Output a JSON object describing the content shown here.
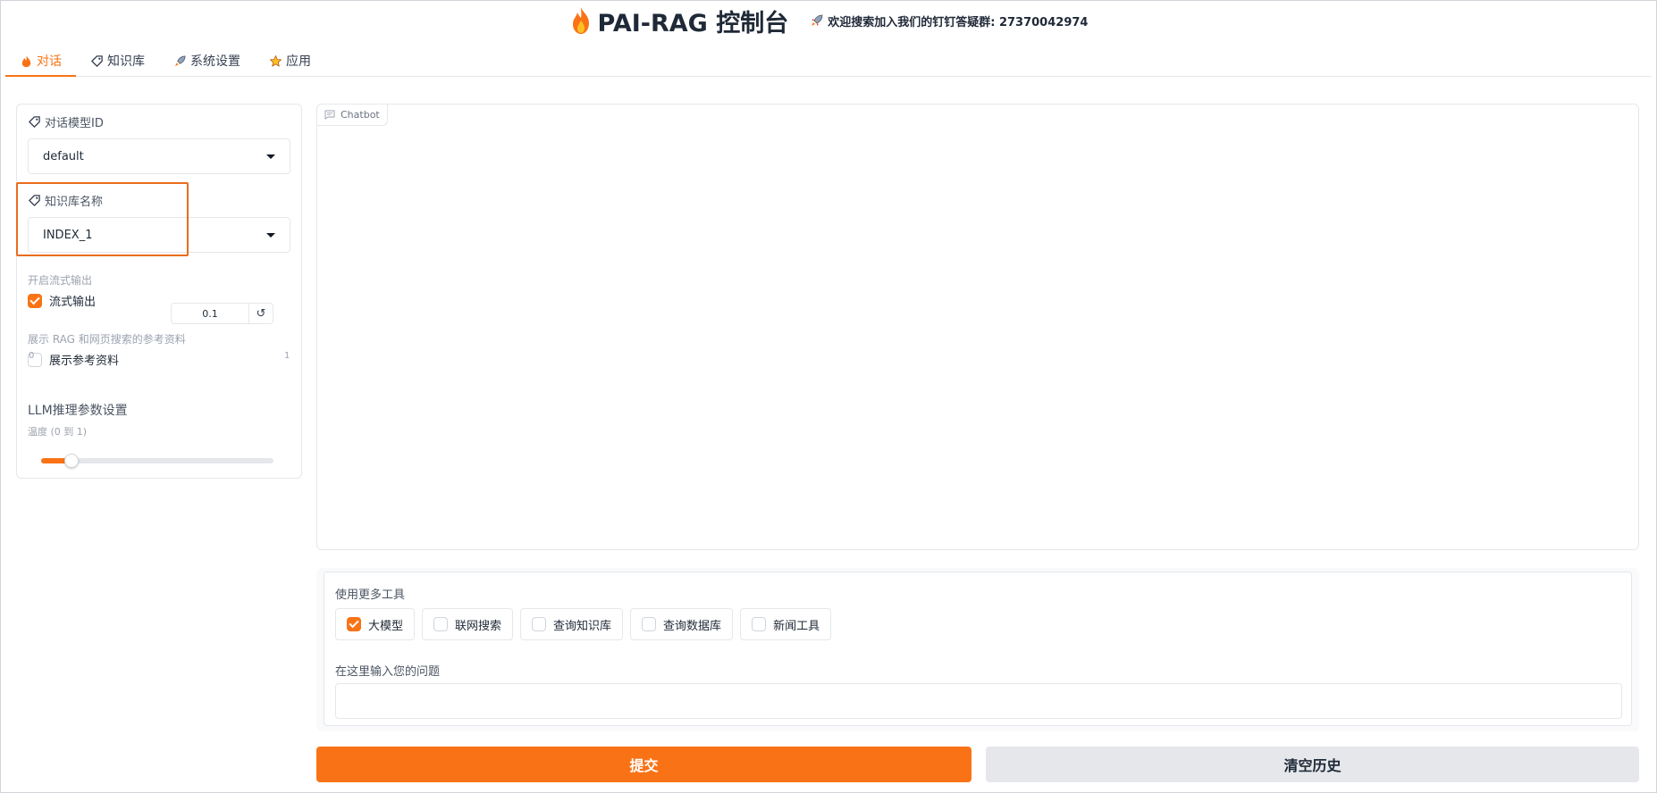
{
  "header": {
    "title": "PAI-RAG 控制台",
    "title_icon": "flame-icon",
    "notice": "欢迎搜索加入我们的钉钉答疑群: 27370042974",
    "notice_icon": "rocket-icon"
  },
  "tabs": [
    {
      "label": "对话",
      "icon": "flame-icon",
      "active": true
    },
    {
      "label": "知识库",
      "icon": "tag-icon",
      "active": false
    },
    {
      "label": "系统设置",
      "icon": "rocket-icon",
      "active": false
    },
    {
      "label": "应用",
      "icon": "star-icon",
      "active": false
    }
  ],
  "left_panel": {
    "model": {
      "label": "对话模型ID",
      "value": "default"
    },
    "index": {
      "label": "知识库名称",
      "value": "INDEX_1"
    },
    "stream": {
      "section_label": "开启流式输出",
      "checkbox_label": "流式输出",
      "checked": true
    },
    "references": {
      "section_label": "展示 RAG 和网页搜索的参考资料",
      "checkbox_label": "展示参考资料",
      "checked": false
    },
    "llm": {
      "title": "LLM推理参数设置",
      "sub_label": "温度 (0 到 1)",
      "value": "0.1",
      "reset_icon": "↺",
      "min": "0",
      "max": "1",
      "fraction": 0.1
    }
  },
  "chatbot": {
    "label": "Chatbot",
    "icon": "chat-icon"
  },
  "tools": {
    "title": "使用更多工具",
    "options": [
      {
        "label": "大模型",
        "checked": true
      },
      {
        "label": "联网搜索",
        "checked": false
      },
      {
        "label": "查询知识库",
        "checked": false
      },
      {
        "label": "查询数据库",
        "checked": false
      },
      {
        "label": "新闻工具",
        "checked": false
      }
    ],
    "question_label": "在这里输入您的问题",
    "question_value": ""
  },
  "buttons": {
    "submit": "提交",
    "clear": "清空历史"
  },
  "colors": {
    "accent": "#f97316",
    "highlight": "#ea6c1e"
  }
}
